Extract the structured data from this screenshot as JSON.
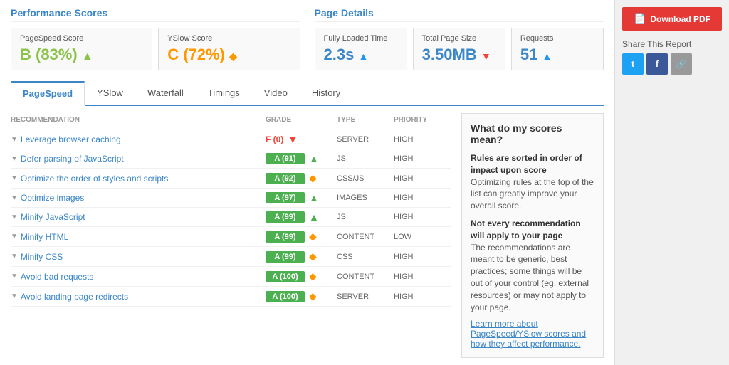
{
  "header": {
    "performance_scores_title": "Performance Scores",
    "page_details_title": "Page Details"
  },
  "scores": {
    "pagespeed": {
      "label": "PageSpeed Score",
      "value": "B (83%)",
      "arrow": "▲"
    },
    "yslow": {
      "label": "YSlow Score",
      "value": "C (72%)",
      "arrow": "◆"
    }
  },
  "page_details": {
    "fully_loaded": {
      "label": "Fully Loaded Time",
      "value": "2.3s",
      "arrow": "▲"
    },
    "total_size": {
      "label": "Total Page Size",
      "value": "3.50MB",
      "arrow": "▼"
    },
    "requests": {
      "label": "Requests",
      "value": "51",
      "arrow": "▲"
    }
  },
  "tabs": [
    {
      "id": "pagespeed",
      "label": "PageSpeed",
      "active": true
    },
    {
      "id": "yslow",
      "label": "YSlow",
      "active": false
    },
    {
      "id": "waterfall",
      "label": "Waterfall",
      "active": false
    },
    {
      "id": "timings",
      "label": "Timings",
      "active": false
    },
    {
      "id": "video",
      "label": "Video",
      "active": false
    },
    {
      "id": "history",
      "label": "History",
      "active": false
    }
  ],
  "table_headers": {
    "recommendation": "RECOMMENDATION",
    "grade": "GRADE",
    "type": "TYPE",
    "priority": "PRIORITY"
  },
  "recommendations": [
    {
      "name": "Leverage browser caching",
      "grade": "F (0)",
      "grade_type": "red",
      "icon": "▼",
      "icon_color": "red",
      "type": "SERVER",
      "priority": "HIGH"
    },
    {
      "name": "Defer parsing of JavaScript",
      "grade": "A (91)",
      "grade_type": "green",
      "icon": "▲",
      "icon_color": "green",
      "type": "JS",
      "priority": "HIGH"
    },
    {
      "name": "Optimize the order of styles and scripts",
      "grade": "A (92)",
      "grade_type": "green",
      "icon": "◆",
      "icon_color": "orange",
      "type": "CSS/JS",
      "priority": "HIGH"
    },
    {
      "name": "Optimize images",
      "grade": "A (97)",
      "grade_type": "green",
      "icon": "▲",
      "icon_color": "green",
      "type": "IMAGES",
      "priority": "HIGH"
    },
    {
      "name": "Minify JavaScript",
      "grade": "A (99)",
      "grade_type": "green",
      "icon": "▲",
      "icon_color": "green",
      "type": "JS",
      "priority": "HIGH"
    },
    {
      "name": "Minify HTML",
      "grade": "A (99)",
      "grade_type": "green",
      "icon": "◆",
      "icon_color": "orange",
      "type": "CONTENT",
      "priority": "LOW"
    },
    {
      "name": "Minify CSS",
      "grade": "A (99)",
      "grade_type": "green",
      "icon": "◆",
      "icon_color": "orange",
      "type": "CSS",
      "priority": "HIGH"
    },
    {
      "name": "Avoid bad requests",
      "grade": "A (100)",
      "grade_type": "green",
      "icon": "◆",
      "icon_color": "orange",
      "type": "CONTENT",
      "priority": "HIGH"
    },
    {
      "name": "Avoid landing page redirects",
      "grade": "A (100)",
      "grade_type": "green",
      "icon": "◆",
      "icon_color": "orange",
      "type": "SERVER",
      "priority": "HIGH"
    }
  ],
  "info_panel": {
    "title": "What do my scores mean?",
    "para1_bold": "Rules are sorted in order of impact upon score",
    "para1_text": "Optimizing rules at the top of the list can greatly improve your overall score.",
    "para2_bold": "Not every recommendation will apply to your page",
    "para2_text": "The recommendations are meant to be generic, best practices; some things will be out of your control (eg. external resources) or may not apply to your page.",
    "link_text": "Learn more about PageSpeed/YSlow scores and how they affect performance."
  },
  "sidebar": {
    "download_label": "Download PDF",
    "share_label": "Share This Report",
    "twitter_label": "t",
    "facebook_label": "f",
    "link_label": "🔗"
  }
}
